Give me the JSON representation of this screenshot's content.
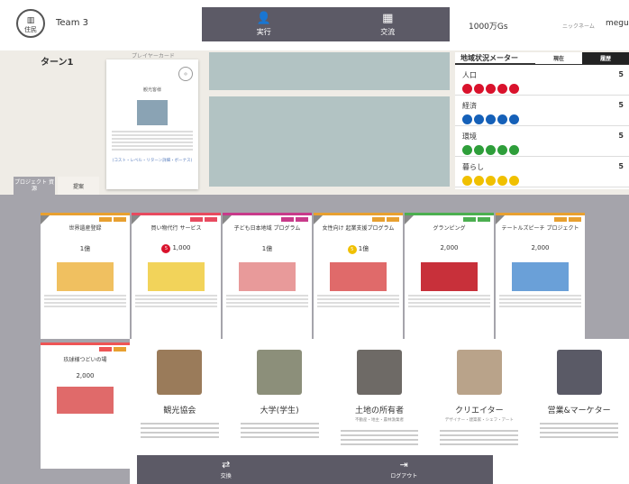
{
  "header": {
    "logo_text": "住民",
    "team": "Team 3",
    "nav": [
      {
        "label": "実行",
        "icon": "person-icon"
      },
      {
        "label": "交流",
        "icon": "grid-icon"
      }
    ],
    "money": "1000万Gs",
    "nickname_label": "ニックネーム",
    "user": "megu"
  },
  "turn": "ターン1",
  "player_card": {
    "label": "プレイヤーカード",
    "title": "観光客様",
    "cost": "(コスト・レベル・リターン詳細・ボーナス)"
  },
  "meter": {
    "title": "地域状況メーター",
    "tabs": [
      "現在",
      "履歴"
    ],
    "rows": [
      {
        "name": "人口",
        "value": "5",
        "color": "#d9122c"
      },
      {
        "name": "経済",
        "value": "5",
        "color": "#1560b8"
      },
      {
        "name": "環境",
        "value": "5",
        "color": "#2e9e3a"
      },
      {
        "name": "暮らし",
        "value": "5",
        "color": "#f0c000"
      }
    ]
  },
  "tabs": [
    "プロジェクト 資源",
    "提案"
  ],
  "project_cards": [
    {
      "title": "世界遺産登録",
      "amount": "1億",
      "color": "#e8a030",
      "badge_color": "",
      "badge": ""
    },
    {
      "title": "買い物代行 サービス",
      "amount": "1,000",
      "color": "#e84a5f",
      "badge_color": "#d9122c",
      "badge": "5"
    },
    {
      "title": "子ども日本地域 プログラム",
      "amount": "1億",
      "color": "#c83a8a",
      "badge_color": "",
      "badge": ""
    },
    {
      "title": "女性向け 起業支援プログラム",
      "amount": "1億",
      "color": "#e8a030",
      "badge_color": "#f0c000",
      "badge": "5"
    },
    {
      "title": "グランピング",
      "amount": "2,000",
      "color": "#4caf50",
      "badge_color": "",
      "badge": ""
    },
    {
      "title": "テートルズピーチ プロジェクト",
      "amount": "2,000",
      "color": "#e8a030",
      "badge_color": "",
      "badge": ""
    }
  ],
  "project_card_row2": {
    "title": "玖球様つどいの場",
    "amount": "2,000"
  },
  "roles": [
    {
      "name": "観光協会",
      "sub": ""
    },
    {
      "name": "大学(学生)",
      "sub": ""
    },
    {
      "name": "土地の所有者",
      "sub": "不動産・地主・農林漁業者"
    },
    {
      "name": "クリエイター",
      "sub": "デザイナー・建築家・シェフ・アート"
    },
    {
      "name": "営業&マーケター",
      "sub": ""
    }
  ],
  "bottom_nav": [
    {
      "label": "交換",
      "icon": "swap-icon"
    },
    {
      "label": "ログアウト",
      "icon": "logout-icon"
    }
  ]
}
